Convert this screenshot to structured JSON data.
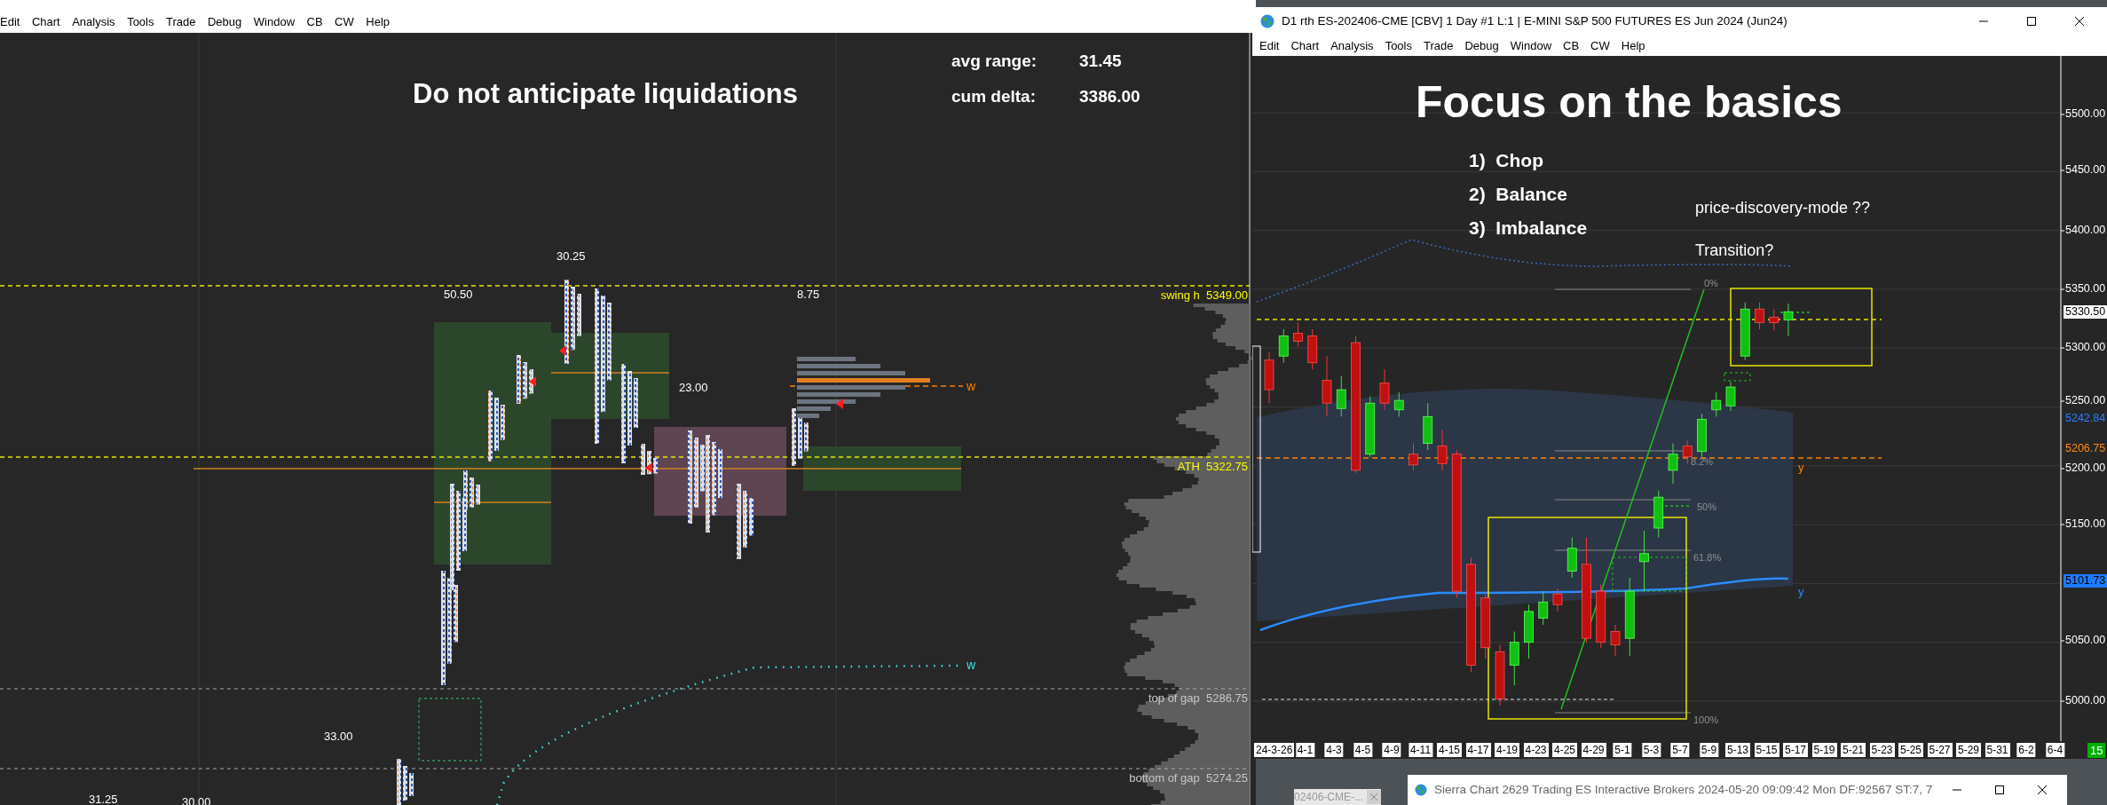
{
  "left_window": {
    "menu": [
      "Edit",
      "Chart",
      "Analysis",
      "Tools",
      "Trade",
      "Debug",
      "Window",
      "CB",
      "CW",
      "Help"
    ],
    "chart": {
      "note": "Do not anticipate liquidations",
      "stats": [
        {
          "label": "avg range:",
          "value": "31.45"
        },
        {
          "label": "cum delta:",
          "value": "3386.00"
        }
      ],
      "range_labels": [
        "30.25",
        "50.50",
        "8.75",
        "23.00",
        "33.00",
        "31.25",
        "30.00"
      ],
      "levels": [
        {
          "text": "swing h  5349.00",
          "color": "#ffff00"
        },
        {
          "text": "ATH  5322.75",
          "color": "#ffff00"
        },
        {
          "text": "top of gap  5286.75",
          "color": "#c8c8c8"
        },
        {
          "text": "bottom of gap  5274.25",
          "color": "#c8c8c8"
        }
      ],
      "line_marks": [
        {
          "text": "w",
          "color": "#ff8000"
        },
        {
          "text": "w",
          "color": "#40e0e0"
        }
      ]
    }
  },
  "right_window": {
    "title": "D1 rth ES-202406-CME [CBV]  1 Day  #1 L:1 | E-MINI S&P 500 FUTURES ES Jun 2024 (Jun24)",
    "menu": [
      "Edit",
      "Chart",
      "Analysis",
      "Tools",
      "Trade",
      "Debug",
      "Window",
      "CB",
      "CW",
      "Help"
    ],
    "chart": {
      "heading": "Focus on the basics",
      "points": [
        "1)  Chop",
        "2)  Balance",
        "3)  Imbalance"
      ],
      "notes": [
        "price-discovery-mode ??",
        "Transition?"
      ],
      "fib_labels": [
        "0%",
        "8.2%",
        "50%",
        "61.8%",
        "100%"
      ],
      "line_marks": [
        {
          "text": "y",
          "color": "#ff8000"
        },
        {
          "text": "y",
          "color": "#2a8cff"
        }
      ],
      "price_ticks": [
        "5500.00",
        "5450.00",
        "5400.00",
        "5350.00",
        "5300.00",
        "5250.00",
        "5200.00",
        "5150.00",
        "5050.00",
        "5000.00"
      ],
      "price_markers": [
        {
          "text": "5330.50",
          "kind": "box",
          "color": "#ffffff"
        },
        {
          "text": "5242.84",
          "kind": "text",
          "color": "#2a7fff"
        },
        {
          "text": "5206.75",
          "kind": "text",
          "color": "#ff8c1a"
        },
        {
          "text": "5101.73",
          "kind": "box",
          "color": "#1e7bff"
        }
      ],
      "dates": [
        "24-3-26",
        "4-1",
        "4-3",
        "4-5",
        "4-9",
        "4-11",
        "4-15",
        "4-17",
        "4-19",
        "4-23",
        "4-25",
        "4-29",
        "5-1",
        "5-3",
        "5-7",
        "5-9",
        "5-13",
        "5-15",
        "5-17",
        "5-19",
        "5-21",
        "5-23",
        "5-25",
        "5-27",
        "5-29",
        "5-31",
        "6-2",
        "6-4"
      ],
      "bar_count": "15"
    }
  },
  "background_tab": {
    "label": "02406-CME-..."
  },
  "sierra_window": {
    "title": "Sierra Chart 2629 Trading ES Interactive Brokers 2024-05-20  09:09:42 Mon DF:92567  ST:7, 7"
  }
}
